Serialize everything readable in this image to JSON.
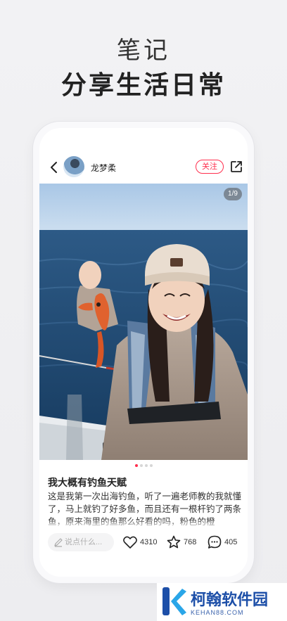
{
  "promo": {
    "subtitle": "笔记",
    "headline": "分享生活日常"
  },
  "post_header": {
    "back_icon": "chevron-left-icon",
    "username": "龙梦柔",
    "follow_label": "关注",
    "share_icon": "share-icon"
  },
  "photo": {
    "counter": "1/9",
    "page_count": 4,
    "active_index": 0
  },
  "post": {
    "title": "我大概有钓鱼天赋",
    "body": "这是我第一次出海钓鱼，听了一遍老师教的我就懂了，马上就钓了好多鱼，而且还有一根杆钓了两条鱼，原来海里的鱼那么好看的吗，粉色的橙"
  },
  "bottom_bar": {
    "comment_placeholder": "说点什么...",
    "likes": "4310",
    "favorites": "768",
    "comments": "405"
  },
  "watermark": {
    "name": "柯翰软件园",
    "domain": "KEHAN88.COM"
  },
  "colors": {
    "accent": "#ff2e4d",
    "watermark_blue": "#1d4fa8"
  }
}
